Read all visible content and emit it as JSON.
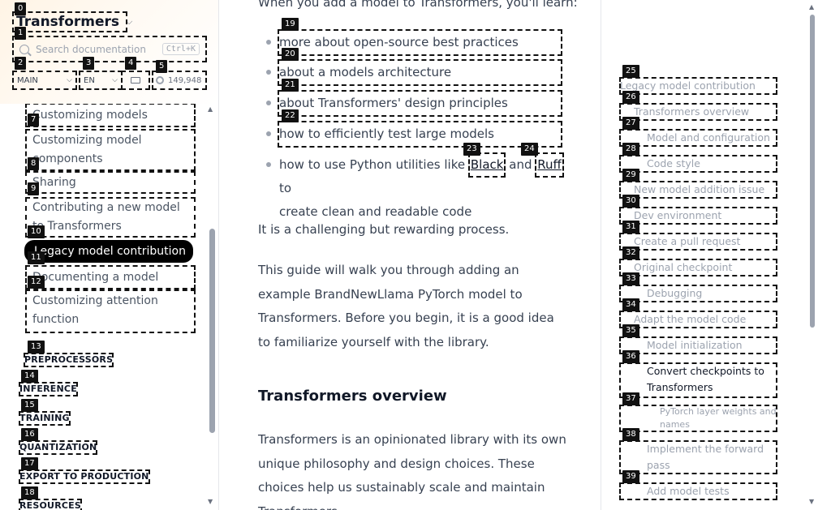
{
  "sidebar": {
    "brand": {
      "title": "Transformers",
      "logo_color": "#f6b20b"
    },
    "search": {
      "placeholder": "Search documentation",
      "shortcut": "Ctrl+K"
    },
    "version": "MAIN",
    "language": "EN",
    "github_stars": "149,948",
    "nav_items": [
      {
        "label": "Customizing models"
      },
      {
        "label": "Customizing model components"
      },
      {
        "label": "Sharing"
      },
      {
        "label": "Contributing a new model to Transformers"
      },
      {
        "label": "Legacy model contribution"
      },
      {
        "label": "Documenting a model"
      },
      {
        "label": "Customizing attention function"
      }
    ],
    "sections": [
      "PREPROCESSORS",
      "INFERENCE",
      "TRAINING",
      "QUANTIZATION",
      "EXPORT TO PRODUCTION",
      "RESOURCES"
    ]
  },
  "main": {
    "intro_partial": "When you add a model to Transformers, you'll learn:",
    "bullets": [
      "more about open-source best practices",
      "about a models architecture",
      "about Transformers' design principles",
      "how to efficiently test large models"
    ],
    "bullet5": {
      "prefix": "how to use Python utilities like",
      "link1": "Black",
      "middle": "and",
      "link2": "Ruff",
      "suffix_line1": "to",
      "line2": "create clean and readable code"
    },
    "para1": "It is a challenging but rewarding process.",
    "para2": "This guide will walk you through adding an example BrandNewLlama PyTorch model to Transformers. Before you begin, it is a good idea to familiarize yourself with the library.",
    "heading": "Transformers overview",
    "para3": "Transformers is an opinionated library with its own unique philosophy and design choices. These choices help us sustainably scale and maintain Transformers."
  },
  "toc": {
    "items": [
      {
        "label": "Legacy model contribution",
        "depth": 0
      },
      {
        "label": "Transformers overview",
        "depth": 1
      },
      {
        "label": "Model and configuration",
        "depth": 2
      },
      {
        "label": "Code style",
        "depth": 2
      },
      {
        "label": "New model addition issue",
        "depth": 1
      },
      {
        "label": "Dev environment",
        "depth": 1
      },
      {
        "label": "Create a pull request",
        "depth": 1
      },
      {
        "label": "Original checkpoint",
        "depth": 1
      },
      {
        "label": "Debugging",
        "depth": 2
      },
      {
        "label": "Adapt the model code",
        "depth": 1
      },
      {
        "label": "Model initialization",
        "depth": 2
      },
      {
        "label": "Convert checkpoints to Transformers",
        "depth": 2,
        "current": true
      },
      {
        "label": "PyTorch layer weights and names",
        "depth": 3
      },
      {
        "label": "Implement the forward pass",
        "depth": 2
      },
      {
        "label": "Add model tests",
        "depth": 2
      }
    ]
  },
  "badges": [
    "0",
    "1",
    "2",
    "3",
    "4",
    "5",
    "6",
    "7",
    "8",
    "9",
    "10",
    "11",
    "12",
    "13",
    "14",
    "15",
    "16",
    "17",
    "18",
    "19",
    "20",
    "21",
    "22",
    "23",
    "24",
    "25",
    "26",
    "27",
    "28",
    "29",
    "30",
    "31",
    "32",
    "33",
    "34",
    "35",
    "36",
    "37",
    "38",
    "39"
  ]
}
